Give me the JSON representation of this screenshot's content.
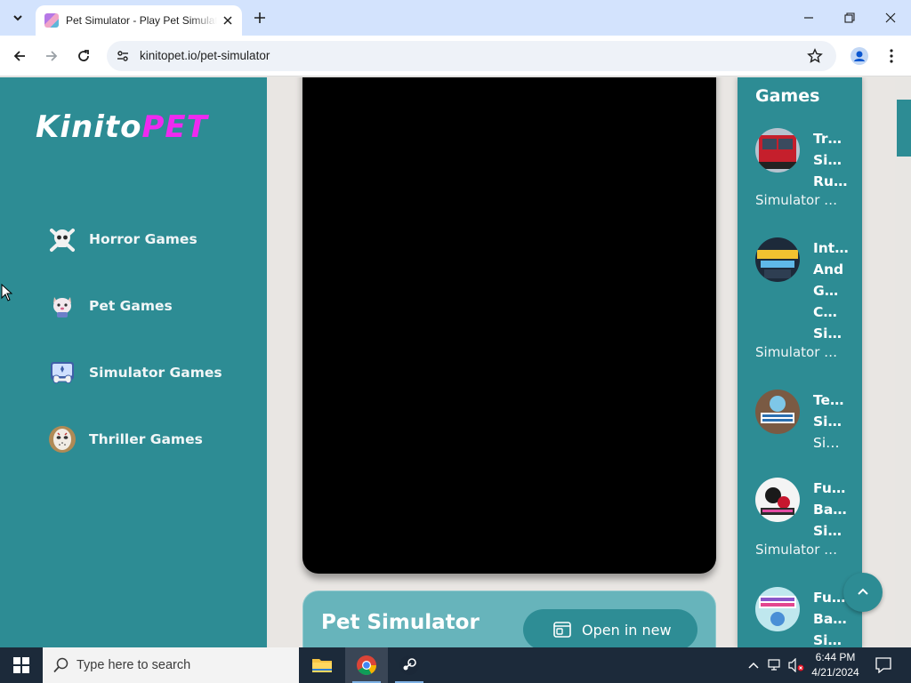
{
  "browser": {
    "tab_title": "Pet Simulator - Play Pet Simulator",
    "url": "kinitopet.io/pet-simulator"
  },
  "page": {
    "logo": {
      "part1": "Kinito",
      "part2": "PET"
    },
    "sidebar": [
      {
        "label": "Horror Games",
        "icon": "skull-icon"
      },
      {
        "label": "Pet Games",
        "icon": "pet-icon"
      },
      {
        "label": "Simulator Games",
        "icon": "gamepad-icon"
      },
      {
        "label": "Thriller Games",
        "icon": "mask-icon"
      }
    ],
    "game_title": "Pet Simulator",
    "open_button": "Open in new",
    "right_panel": {
      "heading": "Games",
      "games": [
        {
          "title_lines": [
            "Tr…",
            "Si…",
            "Ru…"
          ],
          "category": "Simulator …"
        },
        {
          "title_lines": [
            "Int…",
            "And",
            "G…",
            "C…",
            "Si…"
          ],
          "category": "Simulator …"
        },
        {
          "title_lines": [
            "Te…",
            "Si…",
            "Si…"
          ],
          "category": ""
        },
        {
          "title_lines": [
            "Fu…",
            "Ba…",
            "Si…"
          ],
          "category": "Simulator …"
        },
        {
          "title_lines": [
            "Fu…",
            "Ba…",
            "Si…"
          ],
          "category": ""
        }
      ]
    },
    "colors": {
      "teal": "#2d8c94",
      "magenta": "#ee2af0",
      "card": "#67b4bb"
    }
  },
  "taskbar": {
    "search_placeholder": "Type here to search",
    "time": "6:44 PM",
    "date": "4/21/2024"
  }
}
